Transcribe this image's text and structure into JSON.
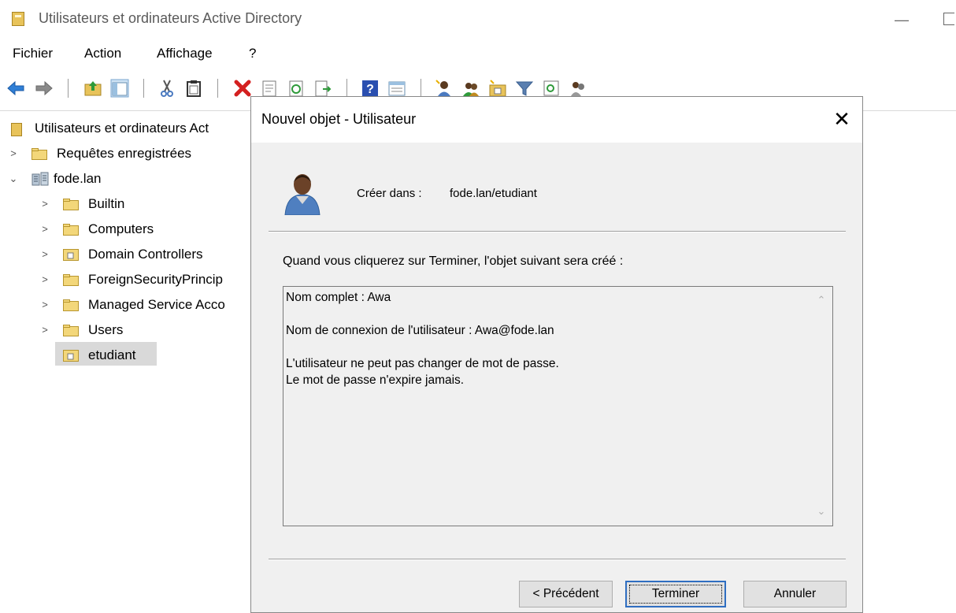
{
  "window": {
    "title": "Utilisateurs et ordinateurs Active Directory",
    "minimize_glyph": "—"
  },
  "menu": [
    "Fichier",
    "Action",
    "Affichage",
    "?"
  ],
  "toolbar_icons": [
    "back-arrow-icon",
    "forward-arrow-icon",
    "up-folder-icon",
    "show-console-tree-icon",
    "cut-icon",
    "paste-icon",
    "delete-icon",
    "properties-icon",
    "refresh-icon",
    "export-list-icon",
    "help-icon",
    "console-view-icon",
    "new-user-icon",
    "new-group-icon",
    "new-ou-icon",
    "filter-icon",
    "find-icon",
    "add-to-group-icon"
  ],
  "tree": {
    "root_label": "Utilisateurs et ordinateurs Act",
    "saved_queries": "Requêtes enregistrées",
    "domain": "fode.lan",
    "children": [
      "Builtin",
      "Computers",
      "Domain Controllers",
      "ForeignSecurityPrincip",
      "Managed Service Acco",
      "Users",
      "etudiant"
    ],
    "selected": "etudiant"
  },
  "dialog": {
    "title": "Nouvel objet - Utilisateur",
    "close_glyph": "✕",
    "create_in_label": "Créer dans :",
    "create_in_value": "fode.lan/etudiant",
    "instruction": "Quand vous cliquerez sur Terminer, l'objet suivant sera créé :",
    "summary": {
      "line1": "Nom complet : Awa",
      "line2": "Nom de connexion de l'utilisateur : Awa@fode.lan",
      "line3": "L'utilisateur ne peut pas changer de mot de passe.",
      "line4": "Le mot de passe n'expire jamais."
    },
    "buttons": {
      "previous": "< Précédent",
      "finish": "Terminer",
      "cancel": "Annuler"
    }
  }
}
